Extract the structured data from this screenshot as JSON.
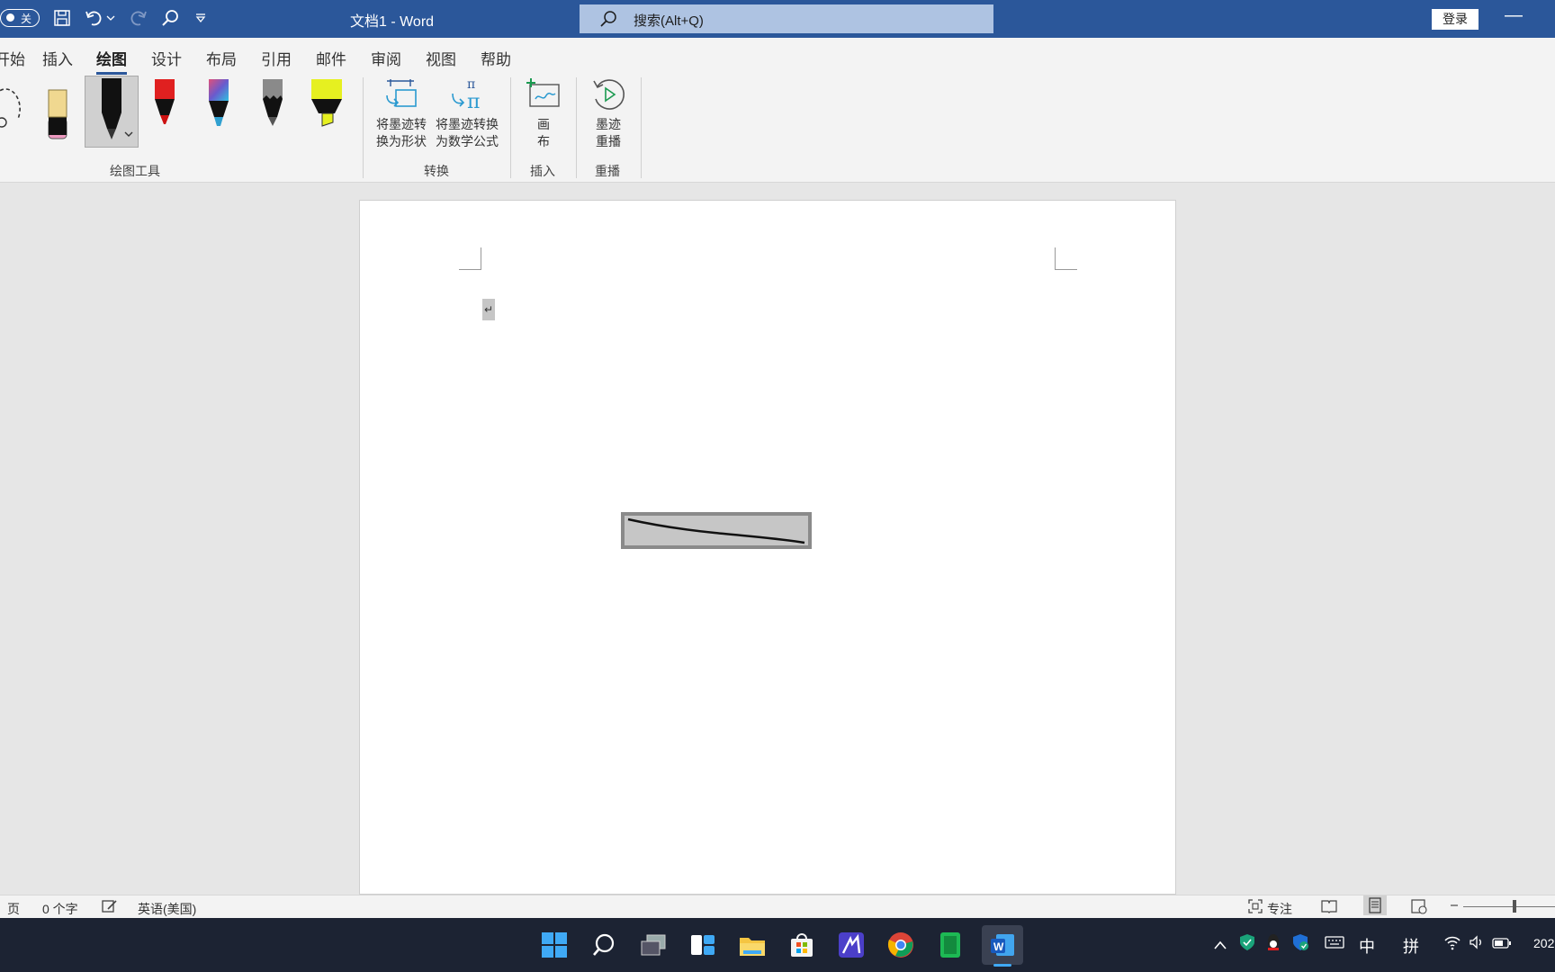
{
  "titlebar": {
    "autosave_label": "关",
    "doc_title": "文档1  -  Word",
    "search_placeholder": "搜索(Alt+Q)",
    "login_label": "登录",
    "minimize_glyph": "—"
  },
  "ribbon": {
    "tabs": [
      "开始",
      "插入",
      "绘图",
      "设计",
      "布局",
      "引用",
      "邮件",
      "审阅",
      "视图",
      "帮助"
    ],
    "active_tab": "绘图",
    "groups": {
      "draw_tools": "绘图工具",
      "convert": "转换",
      "insert": "插入",
      "replay": "重播"
    },
    "buttons": {
      "ink_to_shape": [
        "将墨迹转",
        "换为形状"
      ],
      "ink_to_math": [
        "将墨迹转换",
        "为数学公式"
      ],
      "canvas": [
        "画",
        "布"
      ],
      "ink_replay": [
        "墨迹",
        "重播"
      ]
    },
    "pens": [
      {
        "name": "eraser",
        "color": "#f0d890"
      },
      {
        "name": "black-pen",
        "color": "#111111"
      },
      {
        "name": "red-pen",
        "color": "#e02020"
      },
      {
        "name": "galaxy-pen",
        "color": "#6a5acd"
      },
      {
        "name": "pencil",
        "color": "#8a8a8a"
      },
      {
        "name": "highlighter",
        "color": "#e6f020"
      }
    ]
  },
  "document": {
    "paragraph_mark": "↵"
  },
  "statusbar": {
    "page": "页",
    "word_count": "0 个字",
    "language": "英语(美国)",
    "focus": "专注"
  },
  "taskbar": {
    "tray_ime1": "中",
    "tray_ime2": "拼",
    "clock_partial": "202"
  }
}
